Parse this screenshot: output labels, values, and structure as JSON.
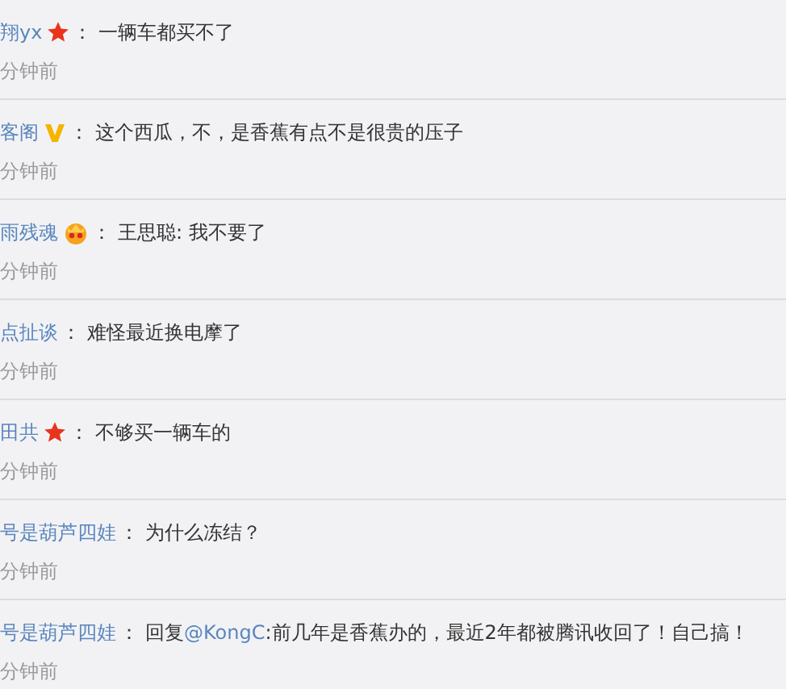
{
  "comments": [
    {
      "user": "翔yx",
      "kind": "star",
      "separator": "：",
      "text": "一辆车都买不了",
      "time": "分钟前"
    },
    {
      "user": "客阁",
      "kind": "vip",
      "separator": "：",
      "text": "这个西瓜，不，是香蕉有点不是很贵的压子",
      "time": "分钟前"
    },
    {
      "user": "雨残魂",
      "kind": "crown",
      "separator": "：",
      "text": "王思聪: 我不要了",
      "time": "分钟前"
    },
    {
      "user": "点扯谈",
      "kind": "plain",
      "separator": "：",
      "text": "难怪最近换电摩了",
      "time": "分钟前"
    },
    {
      "user": "田共",
      "kind": "star",
      "separator": "：",
      "text": "不够买一辆车的",
      "time": "分钟前"
    },
    {
      "user": "号是葫芦四娃",
      "kind": "plain",
      "separator": "：",
      "text": "为什么冻结？",
      "time": "分钟前"
    },
    {
      "user": "号是葫芦四娃",
      "kind": "plain",
      "separator": "：",
      "reply_prefix": "回复",
      "reply_to": "@KongC",
      "text": ":前几年是香蕉办的，最近2年都被腾讯收回了！自己搞！",
      "time": "分钟前"
    }
  ]
}
